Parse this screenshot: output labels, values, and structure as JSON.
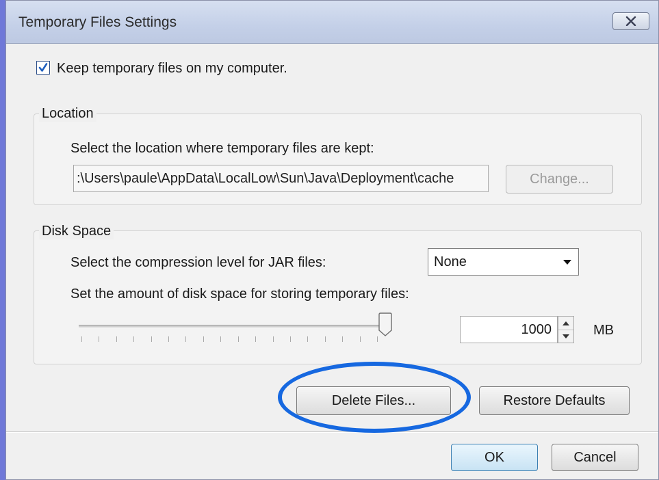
{
  "window": {
    "title": "Temporary Files Settings"
  },
  "keep_files": {
    "label": "Keep temporary files on my computer.",
    "checked": true
  },
  "location": {
    "legend": "Location",
    "instruction": "Select the location where temporary files are kept:",
    "path": ":\\Users\\paule\\AppData\\LocalLow\\Sun\\Java\\Deployment\\cache",
    "change_button": "Change..."
  },
  "disk_space": {
    "legend": "Disk Space",
    "compression_label": "Select the compression level for JAR files:",
    "compression_value": "None",
    "amount_label": "Set the amount of disk space for storing temporary files:",
    "amount_value": "1000",
    "unit": "MB",
    "slider_fraction": 1.0
  },
  "actions": {
    "delete_button": "Delete Files...",
    "restore_button": "Restore Defaults"
  },
  "footer": {
    "ok_button": "OK",
    "cancel_button": "Cancel"
  },
  "colors": {
    "highlight": "#1668e0",
    "checkbox_mark": "#1f5fbf"
  },
  "icons": {
    "close": "close-icon",
    "dropdown": "chevron-down-icon",
    "spin_up": "spin-up-icon",
    "spin_down": "spin-down-icon"
  }
}
